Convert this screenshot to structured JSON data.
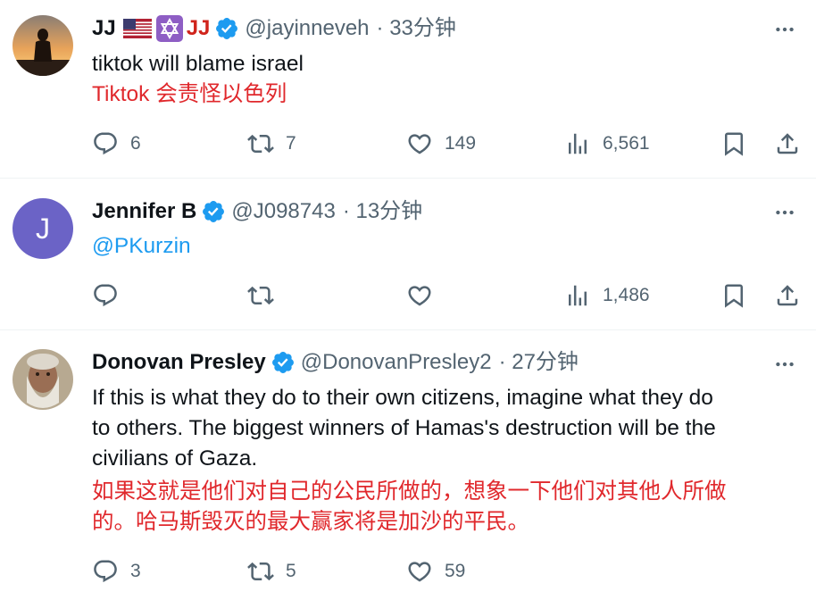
{
  "tweets": [
    {
      "name": "JJ",
      "name_suffix": "JJ",
      "handle": "@jayinneveh",
      "time": "· 33分钟",
      "text": "tiktok will blame israel",
      "translation": "Tiktok 会责怪以色列",
      "replies": "6",
      "retweets": "7",
      "likes": "149",
      "views": "6,561"
    },
    {
      "avatar_letter": "J",
      "name": "Jennifer B",
      "handle": "@J098743",
      "time": "· 13分钟",
      "mention": "@PKurzin",
      "views": "1,486"
    },
    {
      "name": "Donovan Presley",
      "handle": "@DonovanPresley2",
      "time": "· 27分钟",
      "text_line1": "If this is what they do to their own citizens, imagine what they do",
      "text_line2": "to others. The biggest winners of Hamas's destruction will be the",
      "text_line3": "civilians of Gaza.",
      "translation_line1": "如果这就是他们对自己的公民所做的，想象一下他们对其他人所做",
      "translation_line2": "的。哈马斯毁灭的最大赢家将是加沙的平民。",
      "replies": "3",
      "retweets": "5",
      "likes": "59"
    }
  ],
  "colors": {
    "verified": "#1d9bf0",
    "translation": "#e0282c",
    "icon": "#536471",
    "avatar_purple": "#6b63c6"
  }
}
